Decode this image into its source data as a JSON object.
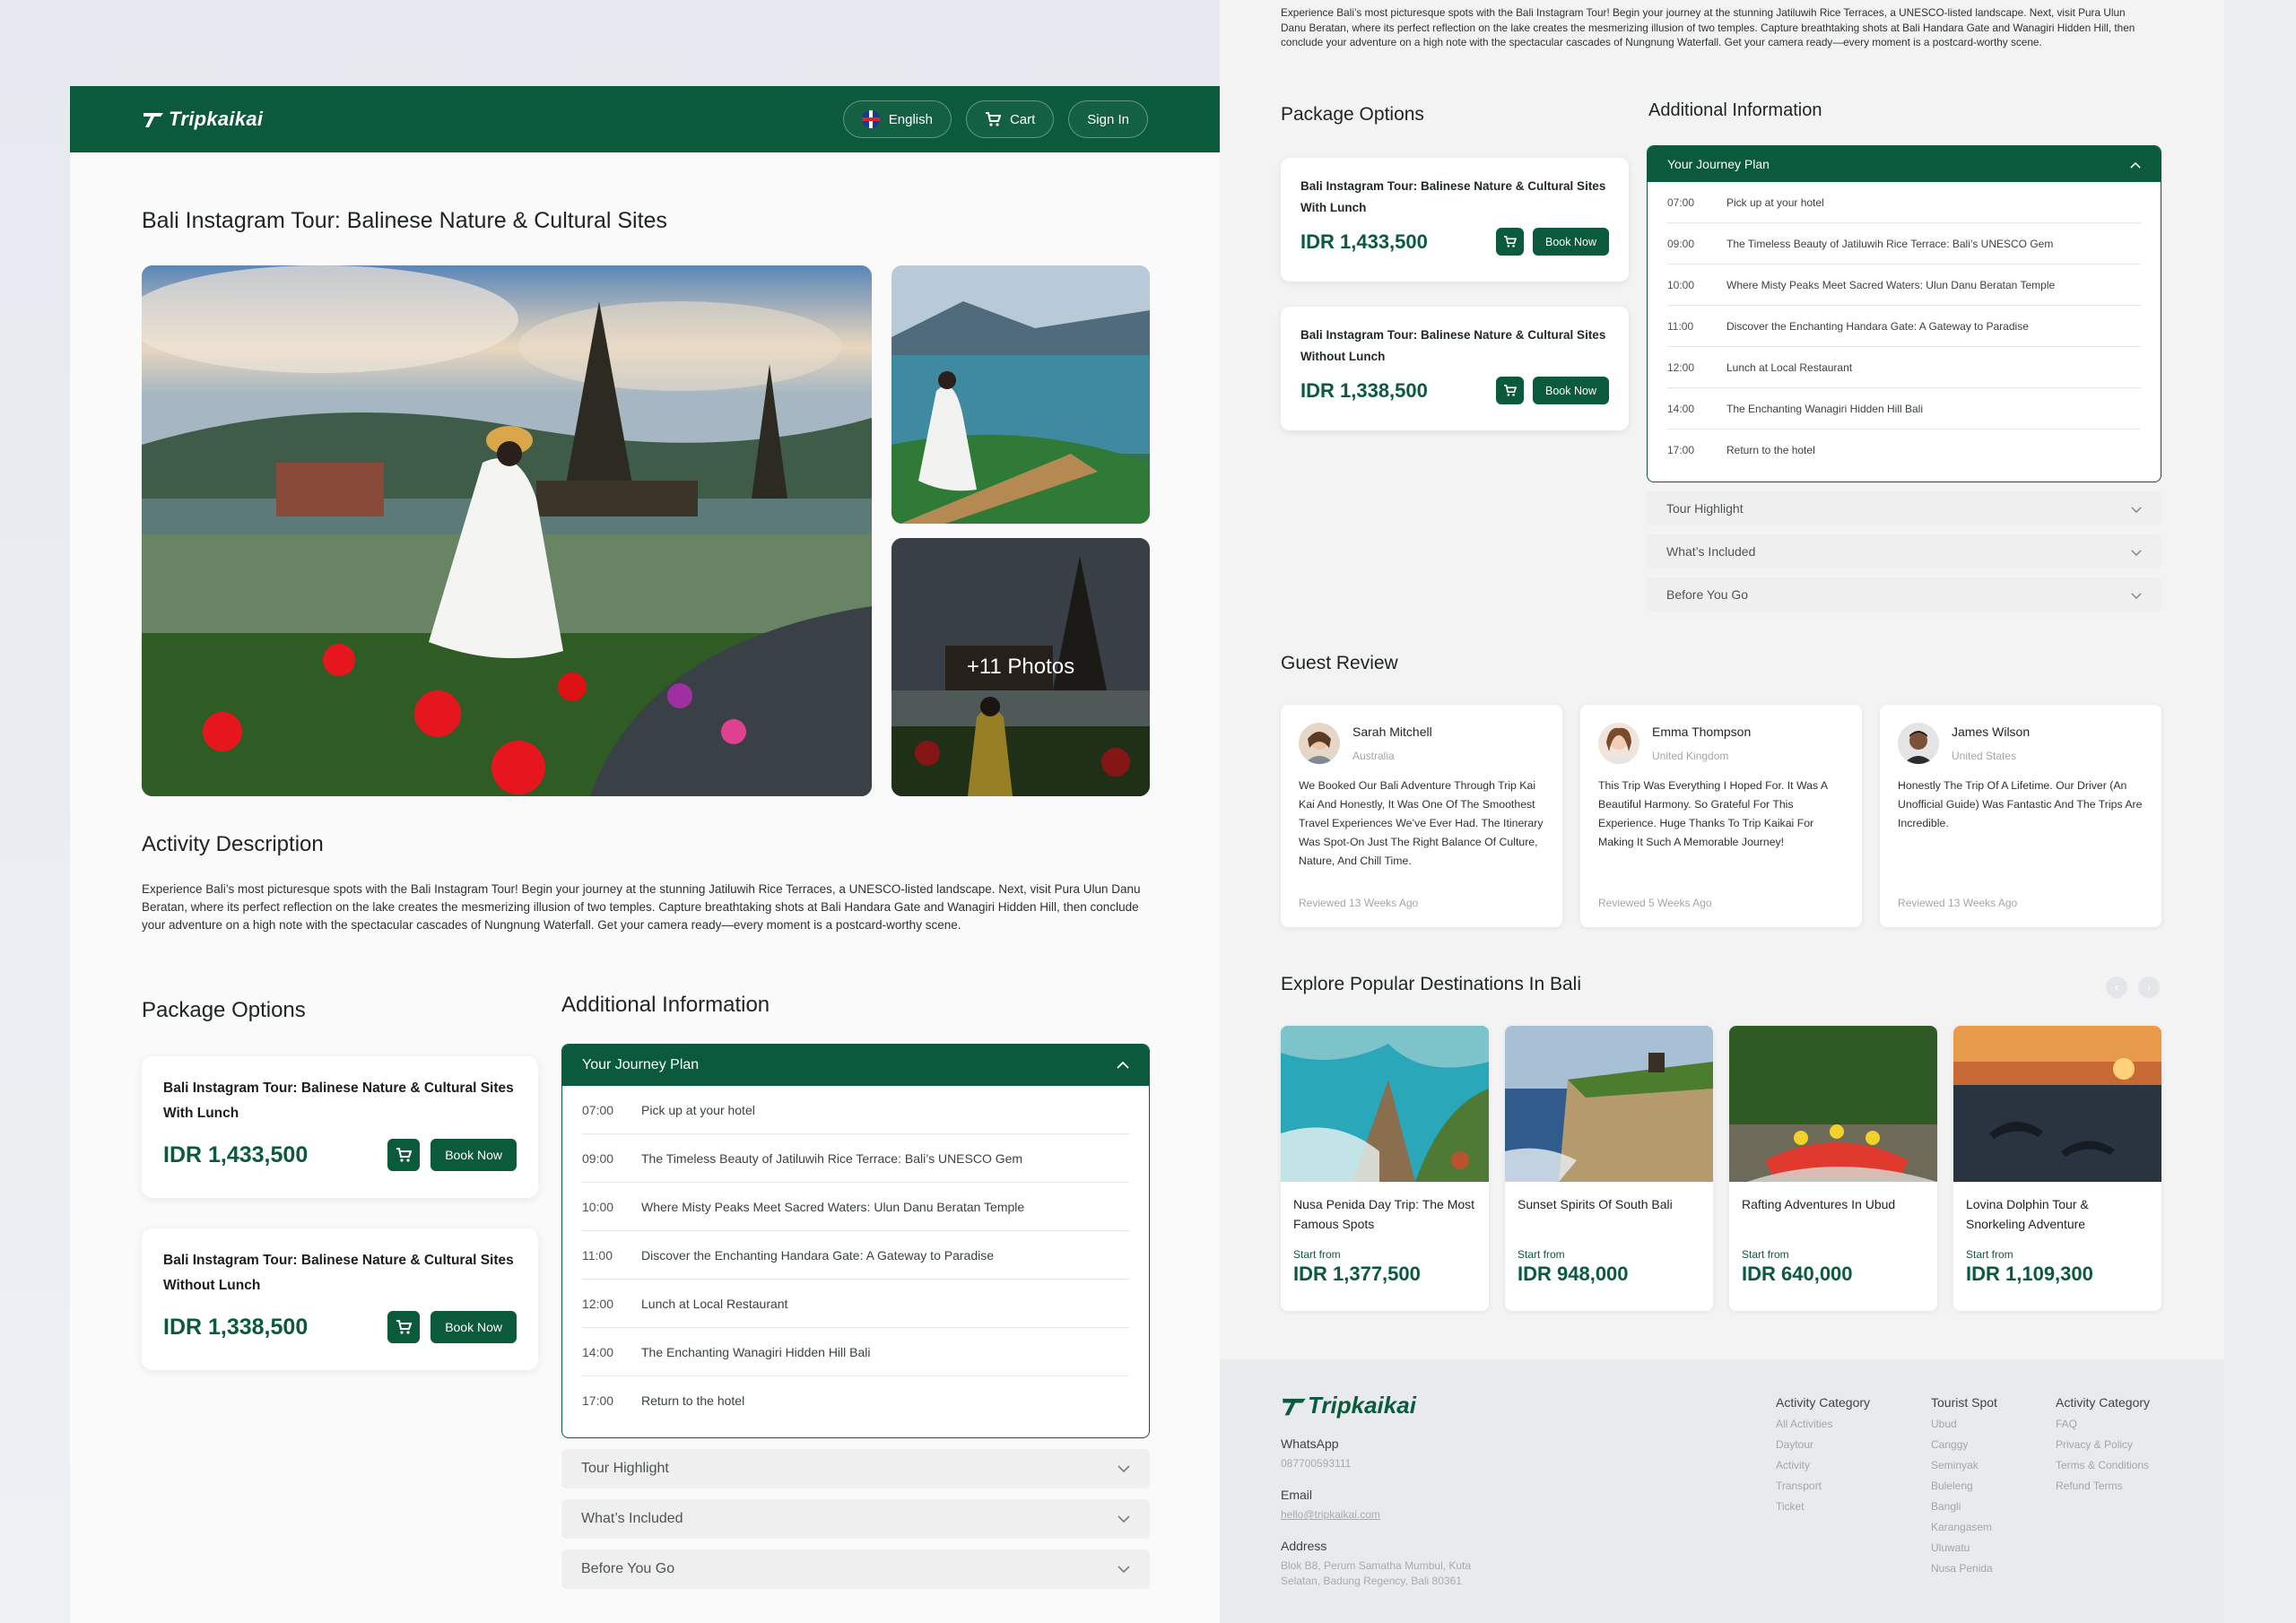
{
  "brand": {
    "name": "Tripkaikai"
  },
  "nav": {
    "language": "English",
    "cart": "Cart",
    "signin": "Sign In"
  },
  "page_title": "Bali Instagram Tour: Balinese Nature & Cultural Sites",
  "gallery": {
    "more_photos": "+11 Photos"
  },
  "activity": {
    "heading": "Activity Description",
    "text": "Experience Bali’s most picturesque spots with the Bali Instagram Tour! Begin your journey at the stunning Jatiluwih Rice Terraces, a UNESCO-listed landscape. Next, visit Pura Ulun Danu Beratan, where its perfect reflection on the lake creates the mesmerizing illusion of two temples. Capture breathtaking shots at Bali Handara Gate and Wanagiri Hidden Hill, then conclude your adventure on a high note with the spectacular cascades of Nungnung Waterfall. Get your camera ready—every moment is a postcard-worthy scene."
  },
  "packages": {
    "heading": "Package Options",
    "book_label": "Book Now",
    "items": [
      {
        "name": "Bali Instagram Tour: Balinese Nature & Cultural Sites With Lunch",
        "price": "IDR 1,433,500"
      },
      {
        "name": "Bali Instagram Tour: Balinese Nature & Cultural Sites Without Lunch",
        "price": "IDR 1,338,500"
      }
    ]
  },
  "additional": {
    "heading": "Additional Information",
    "journey_title": "Your Journey Plan",
    "journey": [
      {
        "time": "07:00",
        "text": "Pick up at your hotel"
      },
      {
        "time": "09:00",
        "text": "The Timeless Beauty of Jatiluwih Rice Terrace: Bali’s UNESCO Gem"
      },
      {
        "time": "10:00",
        "text": "Where Misty Peaks Meet Sacred Waters: Ulun Danu Beratan Temple"
      },
      {
        "time": "11:00",
        "text": "Discover the Enchanting Handara Gate: A Gateway to Paradise"
      },
      {
        "time": "12:00",
        "text": "Lunch at Local Restaurant"
      },
      {
        "time": "14:00",
        "text": "The Enchanting Wanagiri Hidden Hill Bali"
      },
      {
        "time": "17:00",
        "text": "Return to the hotel"
      }
    ],
    "sections": [
      "Tour Highlight",
      "What’s Included",
      "Before You Go"
    ]
  },
  "reviews": {
    "heading": "Guest Review",
    "items": [
      {
        "name": "Sarah Mitchell",
        "country": "Australia",
        "text": "We Booked Our Bali Adventure Through Trip Kai Kai And Honestly, It Was One Of The Smoothest Travel Experiences We’ve Ever Had. The Itinerary Was Spot-On Just The Right Balance Of Culture, Nature, And Chill Time.",
        "when": "Reviewed 13 Weeks Ago"
      },
      {
        "name": "Emma Thompson",
        "country": "United Kingdom",
        "text": "This Trip Was Everything I Hoped For. It Was A Beautiful Harmony. So Grateful For This Experience. Huge Thanks To Trip Kaikai For Making It Such A Memorable Journey!",
        "when": "Reviewed 5 Weeks Ago"
      },
      {
        "name": "James Wilson",
        "country": "United States",
        "text": "Honestly The Trip Of A Lifetime. Our Driver (An Unofficial Guide) Was Fantastic And The Trips Are Incredible.",
        "when": "Reviewed 13 Weeks Ago"
      }
    ]
  },
  "destinations": {
    "heading": "Explore Popular Destinations In Bali",
    "start_from": "Start from",
    "items": [
      {
        "name": "Nusa Penida Day Trip: The Most Famous Spots",
        "price": "IDR 1,377,500"
      },
      {
        "name": "Sunset Spirits Of South Bali",
        "price": "IDR 948,000"
      },
      {
        "name": "Rafting Adventures In Ubud",
        "price": "IDR 640,000"
      },
      {
        "name": "Lovina Dolphin Tour & Snorkeling Adventure",
        "price": "IDR 1,109,300"
      }
    ]
  },
  "footer": {
    "whatsapp_label": "WhatsApp",
    "whatsapp": "087700593111",
    "email_label": "Email",
    "email": "hello@tripkaikai.com",
    "address_label": "Address",
    "address": "Blok B8, Perum Samatha Mumbul, Kuta Selatan, Badung Regency, Bali 80361",
    "col1": {
      "heading": "Activity Category",
      "items": [
        "All Activities",
        "Daytour",
        "Activity",
        "Transport",
        "Ticket"
      ]
    },
    "col2": {
      "heading": "Tourist Spot",
      "items": [
        "Ubud",
        "Canggy",
        "Seminyak",
        "Buleleng",
        "Bangli",
        "Karangasem",
        "Uluwatu",
        "Nusa Penida"
      ]
    },
    "col3": {
      "heading": "Activity Category",
      "items": [
        "FAQ",
        "Privacy & Policy",
        "Terms & Conditions",
        "Refund Terms"
      ]
    }
  },
  "colors": {
    "brand_green": "#0b5a3b"
  }
}
